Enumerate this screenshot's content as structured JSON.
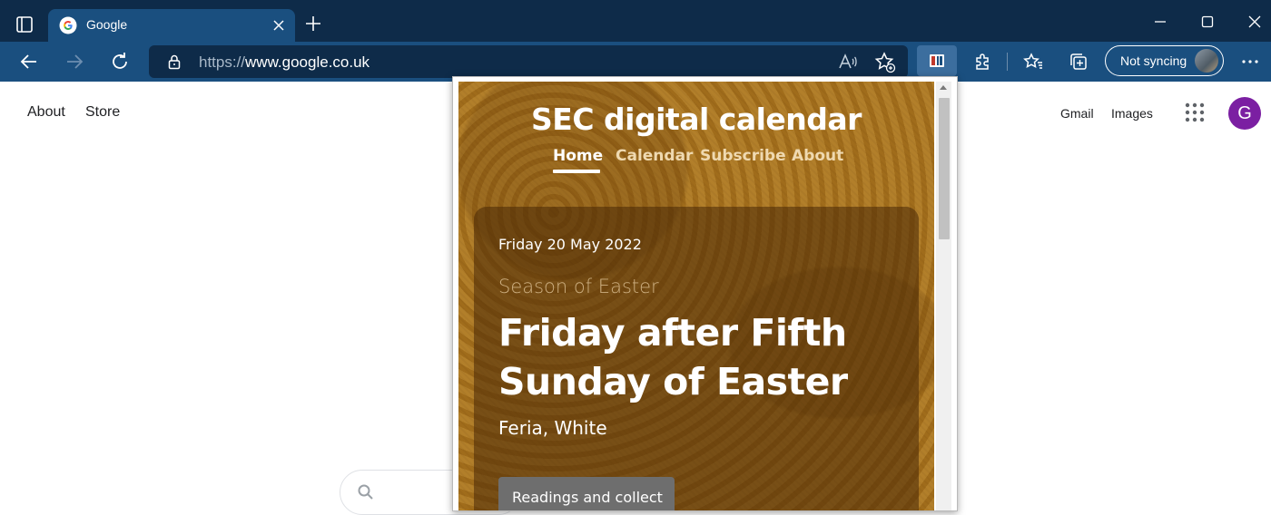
{
  "browser": {
    "tab": {
      "title": "Google"
    },
    "address": {
      "protocol": "https://",
      "host": "www.google.co.uk"
    },
    "sync": {
      "label": "Not syncing"
    }
  },
  "google": {
    "top_left_links": [
      "About",
      "Store"
    ],
    "top_right_links": [
      "Gmail",
      "Images"
    ],
    "avatar_letter": "G"
  },
  "extension": {
    "site_title": "SEC digital calendar",
    "nav": [
      {
        "label": "Home",
        "active": true
      },
      {
        "label": "Calendar",
        "active": false
      },
      {
        "label": "Subscribe",
        "active": false
      },
      {
        "label": "About",
        "active": false
      }
    ],
    "day": {
      "date": "Friday 20 May 2022",
      "season": "Season of Easter",
      "title": "Friday after Fifth Sunday of Easter",
      "rank": "Feria, White"
    },
    "readings_button": "Readings and collect"
  },
  "colors": {
    "titlebar": "#0e2b49",
    "toolbar": "#1a4f7f",
    "avatar": "#7b1fa2",
    "popup_bg": "#a9751f"
  }
}
